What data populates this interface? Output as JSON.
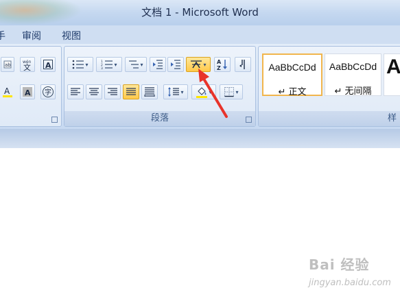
{
  "window": {
    "title": "文档 1 - Microsoft Word"
  },
  "menu": {
    "items": [
      "审阅",
      "视图"
    ]
  },
  "ribbon": {
    "paragraph_group_label": "段落",
    "styles_group_partial_label": "样",
    "font_group_buttons": [
      "phonetic-guide-icon",
      "convert-icon",
      "character-border-icon",
      "font-color-icon",
      "character-shading-icon",
      "enclose-characters-icon"
    ],
    "paragraph_buttons": [
      "bullets-icon",
      "numbering-icon",
      "multilevel-list-icon",
      "decrease-indent-icon",
      "increase-indent-icon",
      "chinese-layout-icon",
      "sort-icon",
      "show-marks-icon",
      "align-left-icon",
      "align-center-icon",
      "align-right-icon",
      "justify-icon",
      "distributed-icon",
      "line-spacing-icon",
      "shading-icon",
      "borders-icon"
    ],
    "styles": [
      {
        "sample": "AaBbCcDd",
        "name": "↵ 正文",
        "selected": true
      },
      {
        "sample": "AaBbCcDd",
        "name": "↵ 无间隔",
        "selected": false
      },
      {
        "sample": "A",
        "name": "",
        "selected": false
      }
    ]
  },
  "colors": {
    "accent_highlight": "#ffc94a",
    "arrow": "#e8332a"
  },
  "watermark": {
    "main": "Bai 经验",
    "sub": "jingyan.baidu.com"
  }
}
